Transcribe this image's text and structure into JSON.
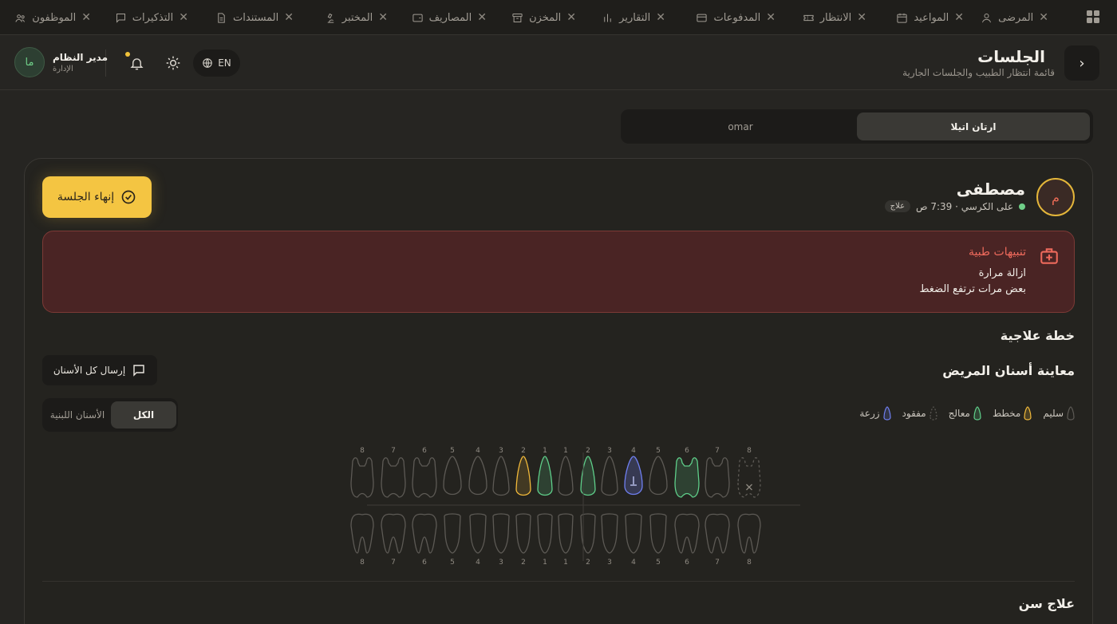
{
  "tabs": [
    {
      "id": "patients",
      "label": "المرضى",
      "icon": "user-icon"
    },
    {
      "id": "appointments",
      "label": "المواعيد",
      "icon": "calendar-icon"
    },
    {
      "id": "waiting",
      "label": "الانتظار",
      "icon": "ticket-icon"
    },
    {
      "id": "payments",
      "label": "المدفوعات",
      "icon": "credit-card-icon"
    },
    {
      "id": "reports",
      "label": "التقارير",
      "icon": "bar-chart-icon"
    },
    {
      "id": "storage",
      "label": "المخزن",
      "icon": "archive-icon"
    },
    {
      "id": "expenses",
      "label": "المصاريف",
      "icon": "wallet-icon"
    },
    {
      "id": "lab",
      "label": "المختبر",
      "icon": "microscope-icon"
    },
    {
      "id": "documents",
      "label": "المستندات",
      "icon": "document-icon"
    },
    {
      "id": "reminders",
      "label": "التذكيرات",
      "icon": "message-icon"
    },
    {
      "id": "staff",
      "label": "الموظفون",
      "icon": "users-icon"
    }
  ],
  "header": {
    "title": "الجلسات",
    "subtitle": "قائمة انتظار الطبيب والجلسات الجارية",
    "lang_label": "EN",
    "user_name": "مدير النظام",
    "user_role": "الإدارة",
    "user_initials": "ما"
  },
  "doctor_tabs": {
    "active": "ارتان اتيلا",
    "other": "omar"
  },
  "session": {
    "patient_initial": "م",
    "patient_name": "مصطفى",
    "status_text": "على الكرسي · 7:39 ص",
    "badge": "علاج",
    "end_button": "إنهاء الجلسة"
  },
  "alerts": {
    "title": "تنبيهات طبية",
    "lines": [
      "ازالة مرارة",
      "بعض مرات ترتفع الضغط"
    ]
  },
  "sections": {
    "treatment_plan": "خطة علاجية",
    "teeth_exam": "معاينة أسنان المريض",
    "send_all": "إرسال كل الأسنان",
    "tooth_treatment": "علاج سن"
  },
  "legend": [
    {
      "label": "سليم",
      "status": "healthy",
      "color": "#5d5a55"
    },
    {
      "label": "مخطط",
      "status": "planned",
      "color": "#f1b93a"
    },
    {
      "label": "معالج",
      "status": "treated",
      "color": "#5fcf8a"
    },
    {
      "label": "مفقود",
      "status": "missing",
      "color": "#5d5a55"
    },
    {
      "label": "زرعة",
      "status": "implant",
      "color": "#6f7ff0"
    }
  ],
  "teeth_toggle": {
    "all": "الكل",
    "primary": "الأسنان اللبنية"
  },
  "chart_data": {
    "type": "dental-chart",
    "numbers": [
      "1",
      "2",
      "3",
      "4",
      "5",
      "6",
      "7",
      "8"
    ],
    "upper_right": [
      "healthy",
      "treated",
      "healthy",
      "implant",
      "healthy",
      "treated",
      "healthy",
      "missing"
    ],
    "upper_left": [
      "treated",
      "planned",
      "healthy",
      "healthy",
      "healthy",
      "healthy",
      "healthy",
      "healthy"
    ],
    "lower_right": [
      "healthy",
      "healthy",
      "healthy",
      "healthy",
      "healthy",
      "healthy",
      "healthy",
      "healthy"
    ],
    "lower_left": [
      "healthy",
      "healthy",
      "healthy",
      "healthy",
      "healthy",
      "healthy",
      "healthy",
      "healthy"
    ]
  },
  "colors": {
    "accent": "#f4c542",
    "alert_bg": "#4a2424",
    "alert_title": "#ee6a5c",
    "healthy_stroke": "#5d5a55",
    "treated": "#5fcf8a",
    "planned": "#f1b93a",
    "implant": "#6f7ff0"
  }
}
